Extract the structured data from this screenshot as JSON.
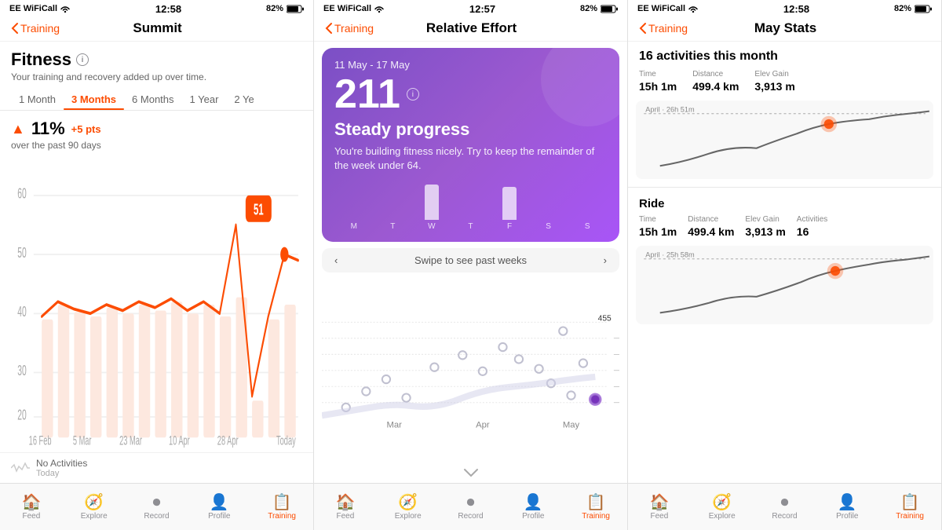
{
  "screen1": {
    "status": {
      "carrier": "EE WiFiCall",
      "time": "12:58",
      "battery": "82%"
    },
    "nav": {
      "back": "Training",
      "title": "Summit"
    },
    "fitness": {
      "title": "Fitness",
      "subtitle": "Your training and recovery added up over time.",
      "tabs": [
        "1 Month",
        "3 Months",
        "6 Months",
        "1 Year",
        "2 Ye"
      ],
      "active_tab": "3 Months",
      "percent": "11%",
      "pts": "+5 pts",
      "period": "over the past 90 days",
      "current_value": "51",
      "x_labels": [
        "16 Feb",
        "5 Mar",
        "23 Mar",
        "10 Apr",
        "28 Apr",
        "Today"
      ]
    },
    "activity": {
      "label": "No Activities",
      "sub": "Today"
    },
    "tabs_bar": [
      {
        "label": "Feed",
        "icon": "🏠"
      },
      {
        "label": "Explore",
        "icon": "🧭"
      },
      {
        "label": "Record",
        "icon": "⏺"
      },
      {
        "label": "Profile",
        "icon": "👤"
      },
      {
        "label": "Training",
        "icon": "📋",
        "active": true
      }
    ]
  },
  "screen2": {
    "status": {
      "carrier": "EE WiFiCall",
      "time": "12:57",
      "battery": "82%"
    },
    "nav": {
      "back": "Training",
      "title": "Relative Effort"
    },
    "card": {
      "date_range": "11 May - 17 May",
      "number": "211",
      "title": "Steady progress",
      "desc": "You're building fitness nicely. Try to keep the remainder of the week under 64.",
      "week_days": [
        "M",
        "T",
        "W",
        "T",
        "F",
        "S",
        "S"
      ],
      "week_heights": [
        0,
        0,
        45,
        0,
        42,
        0,
        0
      ]
    },
    "swipe_label": "Swipe to see past weeks",
    "scatter": {
      "x_labels": [
        "Mar",
        "Apr",
        "May"
      ],
      "y_max": 455,
      "y_labels": [
        "455",
        "",
        "",
        "",
        "",
        ""
      ]
    },
    "chevron": "˅",
    "tabs_bar": [
      {
        "label": "Feed",
        "icon": "🏠"
      },
      {
        "label": "Explore",
        "icon": "🧭"
      },
      {
        "label": "Record",
        "icon": "⏺"
      },
      {
        "label": "Profile",
        "icon": "👤"
      },
      {
        "label": "Training",
        "icon": "📋",
        "active": true
      }
    ]
  },
  "screen3": {
    "status": {
      "carrier": "EE WiFiCall",
      "time": "12:58",
      "battery": "82%"
    },
    "nav": {
      "back": "Training",
      "title": "May Stats"
    },
    "summary": {
      "heading": "16 activities this month",
      "stats": [
        {
          "label": "Time",
          "value": "15h 1m"
        },
        {
          "label": "Distance",
          "value": "499.4 km"
        },
        {
          "label": "Elev Gain",
          "value": "3,913 m"
        }
      ],
      "april_label": "April · 26h 51m"
    },
    "ride": {
      "heading": "Ride",
      "stats": [
        {
          "label": "Time",
          "value": "15h 1m"
        },
        {
          "label": "Distance",
          "value": "499.4 km"
        },
        {
          "label": "Elev Gain",
          "value": "3,913 m"
        },
        {
          "label": "Activities",
          "value": "16"
        }
      ],
      "april_label": "April · 25h 58m"
    },
    "tabs_bar": [
      {
        "label": "Feed",
        "icon": "🏠"
      },
      {
        "label": "Explore",
        "icon": "🧭"
      },
      {
        "label": "Record",
        "icon": "⏺"
      },
      {
        "label": "Profile",
        "icon": "👤"
      },
      {
        "label": "Training",
        "icon": "📋",
        "active": true
      }
    ]
  }
}
